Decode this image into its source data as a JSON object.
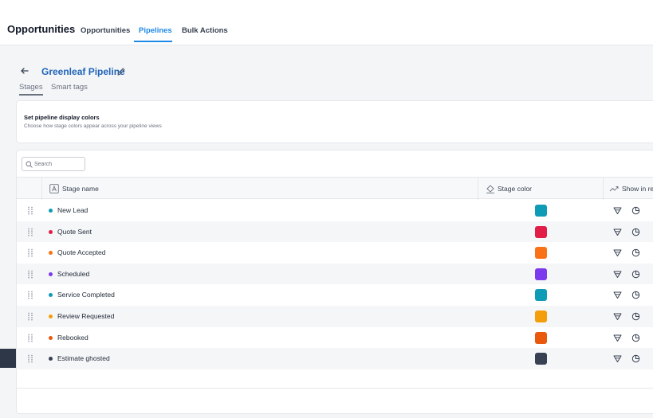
{
  "header": {
    "app_title": "Opportunities",
    "tabs": [
      {
        "label": "Opportunities",
        "active": false
      },
      {
        "label": "Pipelines",
        "active": true
      },
      {
        "label": "Bulk Actions",
        "active": false
      }
    ]
  },
  "pipeline": {
    "title": "Greenleaf Pipeline",
    "subtabs": [
      {
        "label": "Stages",
        "active": true
      },
      {
        "label": "Smart tags",
        "active": false
      }
    ]
  },
  "display_colors": {
    "title": "Set pipeline display colors",
    "description": "Choose how stage colors appear across your pipeline views"
  },
  "search": {
    "placeholder": "Search",
    "value": ""
  },
  "table": {
    "columns": {
      "stage_name": "Stage name",
      "stage_color": "Stage color",
      "show_in": "Show in re"
    },
    "rows": [
      {
        "name": "New Lead",
        "color": "#0e9bb5"
      },
      {
        "name": "Quote Sent",
        "color": "#e11d48"
      },
      {
        "name": "Quote Accepted",
        "color": "#f97316"
      },
      {
        "name": "Scheduled",
        "color": "#7c3aed"
      },
      {
        "name": "Service Completed",
        "color": "#0e9bb5"
      },
      {
        "name": "Review Requested",
        "color": "#f59e0b"
      },
      {
        "name": "Rebooked",
        "color": "#ea580c"
      },
      {
        "name": "Estimate ghosted",
        "color": "#374151"
      }
    ]
  },
  "colors": {
    "accent": "#1e88e5",
    "title_link": "#1e63b8"
  },
  "icons": {
    "back": "arrow-left-icon",
    "edit": "pencil-icon",
    "search": "search-icon",
    "text_type": "text-type-icon",
    "paint": "paint-bucket-icon",
    "trend": "trend-icon",
    "drag": "drag-handle-icon",
    "funnel": "funnel-icon",
    "pie": "pie-chart-icon"
  }
}
